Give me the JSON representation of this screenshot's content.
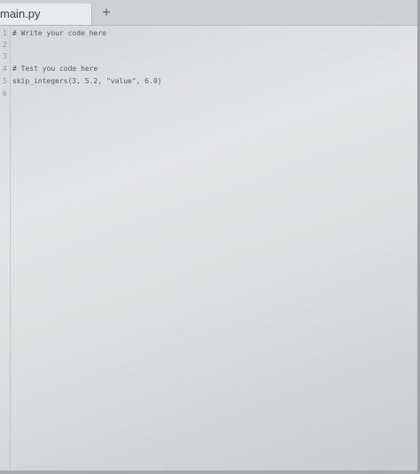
{
  "tab": {
    "title": "main.py",
    "add_label": "+"
  },
  "editor": {
    "lines": [
      {
        "n": "1",
        "text": "# Write your code here"
      },
      {
        "n": "2",
        "text": ""
      },
      {
        "n": "3",
        "text": ""
      },
      {
        "n": "4",
        "text": "# Test you code here"
      },
      {
        "n": "5",
        "text": "skip_integers(3, 5.2, \"value\", 6.0)"
      },
      {
        "n": "6",
        "text": ""
      }
    ]
  }
}
